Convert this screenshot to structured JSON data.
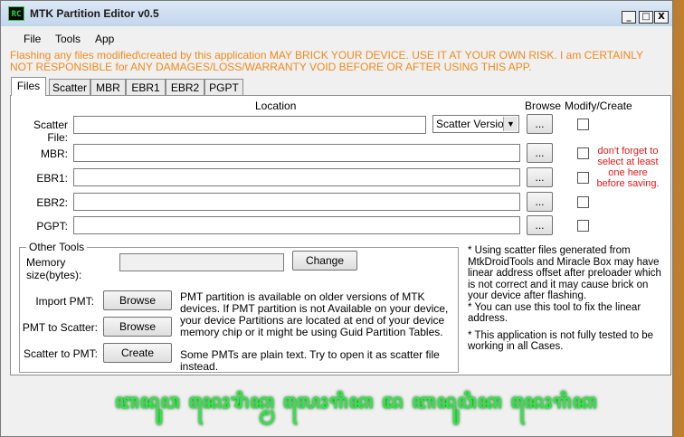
{
  "window": {
    "title": "MTK Partition Editor v0.5",
    "icon_text": "RC"
  },
  "controls": {
    "minimize": "_",
    "maximize": "□",
    "close": "X"
  },
  "menu": [
    "File",
    "Tools",
    "App"
  ],
  "warning": "Flashing any files modified\\created by this application MAY BRICK YOUR DEVICE. USE IT AT YOUR OWN RISK. I am CERTAINLY NOT RESPONSIBLE for ANY DAMAGES/LOSS/WARRANTY VOID BEFORE OR AFTER USING THIS APP.",
  "tabs": [
    "Files",
    "Scatter",
    "MBR",
    "EBR1",
    "EBR2",
    "PGPT"
  ],
  "headers": {
    "location": "Location",
    "browse": "Browse",
    "modify": "Modify/Create"
  },
  "fields": [
    {
      "label": "Scatter File:",
      "value": ""
    },
    {
      "label": "MBR:",
      "value": ""
    },
    {
      "label": "EBR1:",
      "value": ""
    },
    {
      "label": "EBR2:",
      "value": ""
    },
    {
      "label": "PGPT:",
      "value": ""
    }
  ],
  "scatter_version": "Scatter Version",
  "browse_label": "...",
  "note": "don't forget to select at least one here before saving.",
  "other_tools": {
    "legend": "Other Tools",
    "memory_label": "Memory size(bytes):",
    "memory_value": "",
    "change": "Change",
    "import_label": "Import PMT:",
    "import_btn": "Browse",
    "pmt_scatter_label": "PMT to Scatter:",
    "pmt_scatter_btn": "Browse",
    "scatter_pmt_label": "Scatter to PMT:",
    "scatter_pmt_btn": "Create",
    "pmt_desc": "PMT partition is available on older versions of MTK devices. If PMT partition is not Available on your device, your device Partitions are located at end of your device memory chip or it might be using Guid Partition Tables.",
    "pmt_note": "Some PMTs are plain text. Try to open it as scatter file instead."
  },
  "info": [
    "* Using scatter files generated from MtkDroidTools and Miracle Box may have linear address offset after preloader which is not correct and it may cause brick on your device after flashing.",
    "* You can use this tool to fix the linear address.",
    "* This application is not fully tested to be working in all Cases."
  ],
  "banner": "ꦧꦤꦸꦮ ꦤꦺꦴꦫꦶꦏ꧀ꦩ ꦭꦺꦴꦒꦶꦏ ꦢ ꦧꦤꦸꦮꦶꦏ ꦤꦺꦴꦒꦶꦏ"
}
